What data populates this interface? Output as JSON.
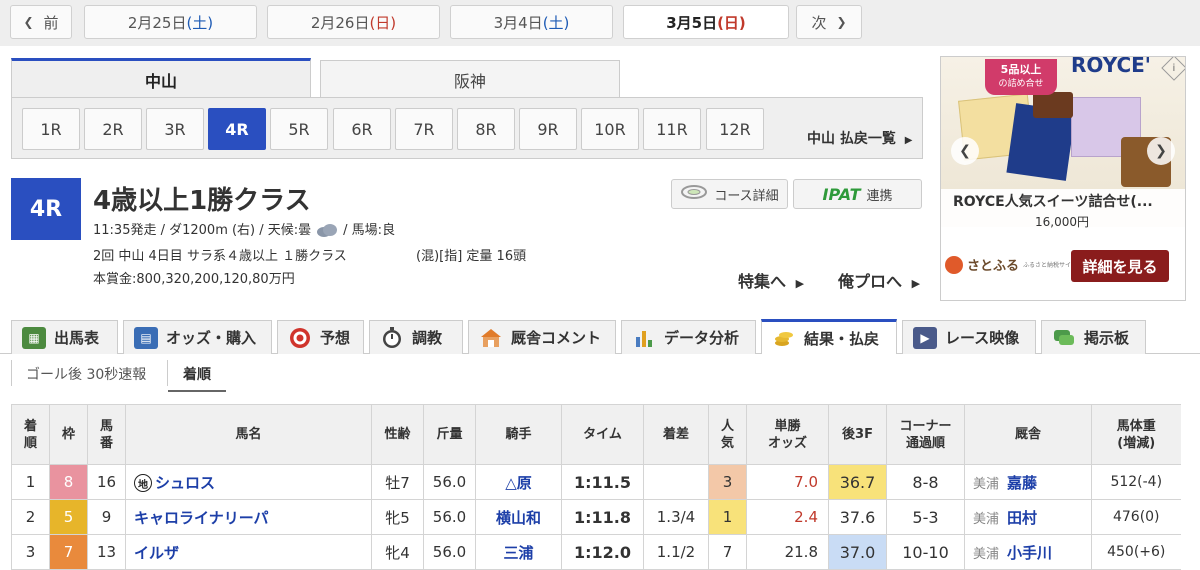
{
  "date_nav": {
    "prev_label": "前",
    "next_label": "次",
    "dates": [
      {
        "date": "2月25日",
        "dow": "(土)",
        "type": "sat"
      },
      {
        "date": "2月26日",
        "dow": "(日)",
        "type": "sun"
      },
      {
        "date": "3月4日",
        "dow": "(土)",
        "type": "sat"
      },
      {
        "date": "3月5日",
        "dow": "(日)",
        "type": "sun",
        "active": true
      }
    ]
  },
  "venues": [
    {
      "label": "中山",
      "active": true
    },
    {
      "label": "阪神",
      "active": false
    }
  ],
  "races": [
    "1R",
    "2R",
    "3R",
    "4R",
    "5R",
    "6R",
    "7R",
    "8R",
    "9R",
    "10R",
    "11R",
    "12R"
  ],
  "active_race": "4R",
  "payout_link": "中山 払戻一覧",
  "race": {
    "badge": "4R",
    "title": "4歳以上1勝クラス",
    "line1": "11:35発走 / ダ1200m (右) / 天候:曇",
    "baba": "/ 馬場:良",
    "line2": "2回 中山 4日目 サラ系４歳以上 １勝クラス",
    "line2b": "(混)[指] 定量 16頭",
    "prize": "本賞金:800,320,200,120,80万円"
  },
  "course_btn": "コース詳細",
  "ipat_logo": "IPAT",
  "ipat_btn": "連携",
  "tokushu_link": "特集へ",
  "orepro_link": "俺プロへ",
  "ad": {
    "badge_main": "5品以上",
    "badge_sub": "の詰め合せ",
    "brand": "ROYCE'",
    "title": "ROYCE人気スイーツ詰合せ(...",
    "price": "16,000円",
    "logo": "さとふる",
    "logo_sub": "ふるさと納税サイト",
    "cta": "詳細を見る",
    "info_icon": "i"
  },
  "nav_tabs": [
    {
      "label": "出馬表",
      "icon": "table-icon",
      "color": "#4c8a3f"
    },
    {
      "label": "オッズ・購入",
      "icon": "odds-icon",
      "color": "#3a6db5"
    },
    {
      "label": "予想",
      "icon": "target-icon",
      "color": "#d0342c"
    },
    {
      "label": "調教",
      "icon": "stopwatch-icon",
      "color": "#555555"
    },
    {
      "label": "厩舎コメント",
      "icon": "stable-icon",
      "color": "#e07b2a"
    },
    {
      "label": "データ分析",
      "icon": "bar-chart-icon",
      "color": "#4a7cc0"
    },
    {
      "label": "結果・払戻",
      "icon": "coins-icon",
      "color": "#d9a520",
      "active": true
    },
    {
      "label": "レース映像",
      "icon": "video-icon",
      "color": "#4a5a8a"
    },
    {
      "label": "掲示板",
      "icon": "chat-icon",
      "color": "#4c9a4a"
    }
  ],
  "sub_tabs": {
    "left": "ゴール後 30秒速報",
    "right": "着順"
  },
  "table": {
    "headers": [
      "着順",
      "枠",
      "馬番",
      "馬名",
      "性齢",
      "斤量",
      "騎手",
      "タイム",
      "着差",
      "人気",
      "単勝オッズ",
      "後3F",
      "コーナー通過順",
      "厩舎",
      "馬体重(増減)"
    ],
    "rows": [
      {
        "rank": "1",
        "waku": "8",
        "umaban": "16",
        "mark": "地",
        "name": "シュロス",
        "sexage": "牡7",
        "kin": "56.0",
        "jockey": "△原",
        "time": "1:11.5",
        "diff": "",
        "pop": "3",
        "odds": "7.0",
        "f3": "36.7",
        "corner": "8-8",
        "area": "美浦",
        "trainer": "嘉藤",
        "weight": "512(-4)"
      },
      {
        "rank": "2",
        "waku": "5",
        "umaban": "9",
        "mark": "",
        "name": "キャロライナリーパ",
        "sexage": "牝5",
        "kin": "56.0",
        "jockey": "横山和",
        "time": "1:11.8",
        "diff": "1.3/4",
        "pop": "1",
        "odds": "2.4",
        "f3": "37.6",
        "corner": "5-3",
        "area": "美浦",
        "trainer": "田村",
        "weight": "476(0)"
      },
      {
        "rank": "3",
        "waku": "7",
        "umaban": "13",
        "mark": "",
        "name": "イルザ",
        "sexage": "牝4",
        "kin": "56.0",
        "jockey": "三浦",
        "time": "1:12.0",
        "diff": "1.1/2",
        "pop": "7",
        "odds": "21.8",
        "f3": "37.0",
        "corner": "10-10",
        "area": "美浦",
        "trainer": "小手川",
        "weight": "450(+6)"
      }
    ]
  },
  "colors": {
    "accent": "#2a4fc0",
    "waku8": "#e9939f",
    "waku5": "#e7b52a",
    "waku7": "#e98a3c",
    "pop_highlight": "#f3c8a8",
    "pop1": "#f8e27a",
    "f3_highlight": "#f8e27a",
    "odds_red": "#c0392b",
    "link_blue": "#1d3fa8"
  }
}
